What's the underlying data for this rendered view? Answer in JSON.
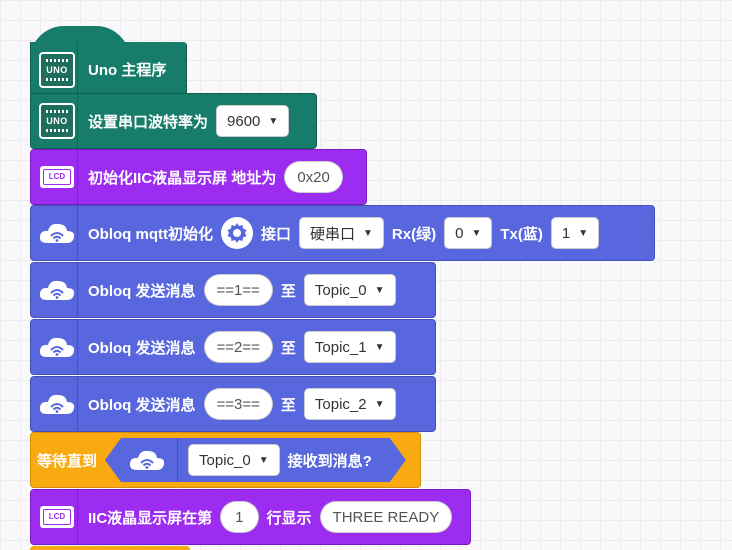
{
  "blocks": {
    "uno_main": {
      "label": "Uno 主程序",
      "icon_text": "UNO"
    },
    "serial_baud": {
      "label": "设置串口波特率为",
      "icon_text": "UNO",
      "baud": "9600"
    },
    "lcd_init": {
      "label": "初始化IIC液晶显示屏 地址为",
      "icon_text": "LCD",
      "address": "0x20"
    },
    "mqtt_init": {
      "label": "Obloq mqtt初始化",
      "port_label": "接口",
      "port_value": "硬串口",
      "rx_label": "Rx(绿)",
      "rx_value": "0",
      "tx_label": "Tx(蓝)",
      "tx_value": "1"
    },
    "send_1": {
      "label": "Obloq 发送消息",
      "message": "==1==",
      "to_label": "至",
      "topic": "Topic_0"
    },
    "send_2": {
      "label": "Obloq 发送消息",
      "message": "==2==",
      "to_label": "至",
      "topic": "Topic_1"
    },
    "send_3": {
      "label": "Obloq 发送消息",
      "message": "==3==",
      "to_label": "至",
      "topic": "Topic_2"
    },
    "wait_until": {
      "label": "等待直到",
      "topic": "Topic_0",
      "suffix": "接收到消息?"
    },
    "lcd_show": {
      "label": "IIC液晶显示屏在第",
      "line": "1",
      "row_label": "行显示",
      "text": "THREE READY",
      "icon_text": "LCD"
    }
  },
  "colors": {
    "arduino": "#177d6a",
    "lcd": "#9c2cf0",
    "obloq": "#5867dd",
    "control": "#f8aa10"
  },
  "icons": {
    "arduino": "uno-board-icon",
    "lcd": "lcd-icon",
    "obloq": "cloud-wifi-icon",
    "setting": "gear-icon",
    "dropdown": "caret-down-icon"
  }
}
